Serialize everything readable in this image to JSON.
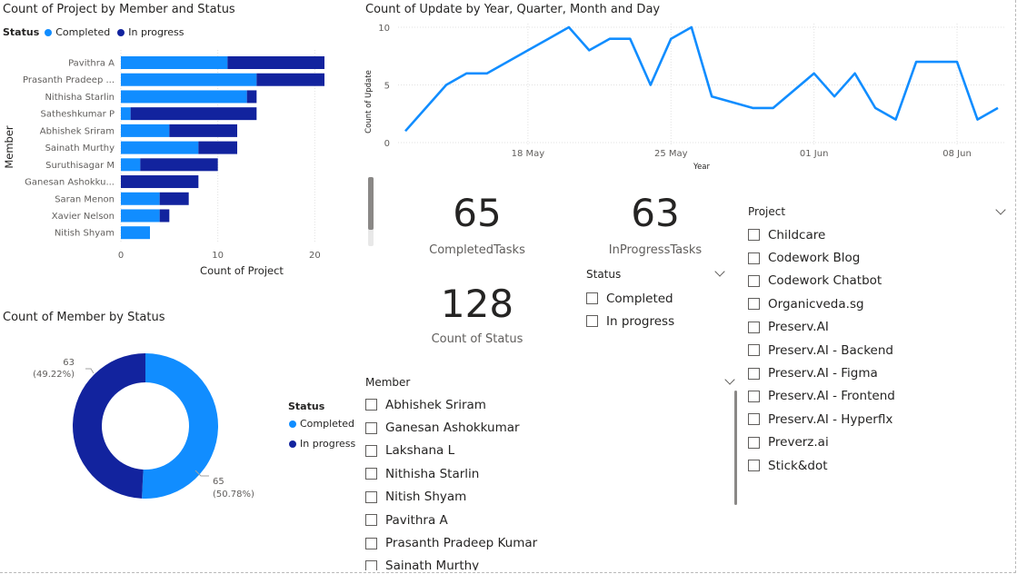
{
  "bar_visual": {
    "title": "Count of Project by Member and Status",
    "legend_title": "Status",
    "legend": [
      {
        "label": "Completed",
        "color": "#118DFF"
      },
      {
        "label": "In progress",
        "color": "#12239E"
      }
    ],
    "ylabel": "Member",
    "xlabel": "Count of Project"
  },
  "line_visual": {
    "title": "Count of Update by Year, Quarter, Month and Day",
    "ylabel": "Count of Update",
    "xlabel": "Year"
  },
  "donut_visual": {
    "title": "Count of Member by Status",
    "legend_title": "Status",
    "legend": [
      {
        "label": "Completed",
        "color": "#118DFF"
      },
      {
        "label": "In progress",
        "color": "#12239E"
      }
    ],
    "labels": [
      {
        "value": "63",
        "pct": "(49.22%)"
      },
      {
        "value": "65",
        "pct": "(50.78%)"
      }
    ]
  },
  "kpis": {
    "completed": {
      "value": "65",
      "label": "CompletedTasks"
    },
    "in_progress": {
      "value": "63",
      "label": "InProgressTasks"
    },
    "total": {
      "value": "128",
      "label": "Count of Status"
    }
  },
  "status_slicer": {
    "title": "Status",
    "items": [
      "Completed",
      "In progress"
    ]
  },
  "project_slicer": {
    "title": "Project",
    "items": [
      "Childcare",
      "Codework Blog",
      "Codework Chatbot",
      "Organicveda.sg",
      "Preserv.AI",
      "Preserv.AI - Backend",
      "Preserv.AI - Figma",
      "Preserv.AI - Frontend",
      "Preserv.AI - Hyperflx",
      "Preverz.ai",
      "Stick&dot"
    ]
  },
  "member_slicer": {
    "title": "Member",
    "items": [
      "Abhishek Sriram",
      "Ganesan Ashokkumar",
      "Lakshana L",
      "Nithisha Starlin",
      "Nitish Shyam",
      "Pavithra A",
      "Prasanth Pradeep Kumar",
      "Sainath Murthy"
    ]
  },
  "chart_data": [
    {
      "type": "bar",
      "title": "Count of Project by Member and Status",
      "xlabel": "Count of Project",
      "ylabel": "Member",
      "orientation": "horizontal",
      "stacked": true,
      "categories": [
        "Pavithra A",
        "Prasanth Pradeep ...",
        "Nithisha Starlin",
        "Satheshkumar P",
        "Abhishek Sriram",
        "Sainath Murthy",
        "Suruthisagar M",
        "Ganesan Ashokku...",
        "Saran Menon",
        "Xavier Nelson",
        "Nitish Shyam"
      ],
      "series": [
        {
          "name": "Completed",
          "color": "#118DFF",
          "values": [
            11,
            14,
            13,
            1,
            5,
            8,
            2,
            0,
            4,
            4,
            3
          ]
        },
        {
          "name": "In progress",
          "color": "#12239E",
          "values": [
            10,
            7,
            1,
            13,
            7,
            4,
            8,
            8,
            3,
            1,
            0
          ]
        }
      ],
      "xlim": [
        0,
        21
      ],
      "xticks": [
        "0",
        "10",
        "20"
      ],
      "grid": true,
      "legend_position": "top-left"
    },
    {
      "type": "line",
      "title": "Count of Update by Year, Quarter, Month and Day",
      "xlabel": "Year",
      "ylabel": "Count of Update",
      "x": [
        "2023-05-12",
        "2023-05-14",
        "2023-05-15",
        "2023-05-16",
        "2023-05-18",
        "2023-05-19",
        "2023-05-20",
        "2023-05-21",
        "2023-05-22",
        "2023-05-23",
        "2023-05-24",
        "2023-05-25",
        "2023-05-26",
        "2023-05-27",
        "2023-05-29",
        "2023-05-30",
        "2023-06-01",
        "2023-06-02",
        "2023-06-03",
        "2023-06-04",
        "2023-06-05",
        "2023-06-06",
        "2023-06-08",
        "2023-06-09",
        "2023-06-10"
      ],
      "x_tick_labels": [
        "18 May",
        "25 May",
        "01 Jun",
        "08 Jun"
      ],
      "series": [
        {
          "color": "#118DFF",
          "values": [
            1,
            5,
            6,
            6,
            8,
            9,
            10,
            8,
            9,
            9,
            5,
            9,
            10,
            4,
            3,
            3,
            6,
            4,
            6,
            3,
            2,
            7,
            7,
            2,
            3
          ]
        }
      ],
      "ylim": [
        0,
        10
      ],
      "yticks": [
        "0",
        "5",
        "10"
      ],
      "grid": true
    },
    {
      "type": "pie",
      "title": "Count of Member by Status",
      "donut": true,
      "categories": [
        "Completed",
        "In progress"
      ],
      "values": [
        65,
        63
      ],
      "colors": [
        "#118DFF",
        "#12239E"
      ],
      "legend_position": "right"
    }
  ]
}
